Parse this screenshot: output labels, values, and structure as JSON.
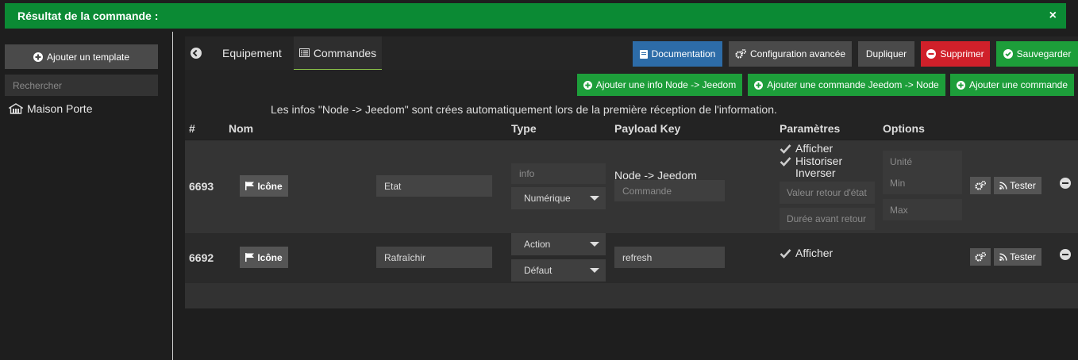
{
  "alert": {
    "text": "Résultat de la commande :",
    "close": "×"
  },
  "sidebar": {
    "add_template_label": "Ajouter un template",
    "search_placeholder": "Rechercher",
    "equipments": [
      {
        "name": "Maison Porte"
      }
    ]
  },
  "tabs": {
    "equipement": "Equipement",
    "commandes": "Commandes"
  },
  "toolbar": {
    "documentation": "Documentation",
    "config_avancee": "Configuration avancée",
    "dupliquer": "Dupliquer",
    "supprimer": "Supprimer",
    "sauvegarder": "Sauvegarder"
  },
  "actions": {
    "add_info": "Ajouter une info Node -> Jeedom",
    "add_cmd_node": "Ajouter une commande Jeedom -> Node",
    "add_cmd": "Ajouter une commande"
  },
  "info_text": "Les infos \"Node -> Jeedom\" sont crées automatiquement lors de la première réception de l'information.",
  "table": {
    "headers": {
      "id": "#",
      "nom": "Nom",
      "type": "Type",
      "payload": "Payload Key",
      "params": "Paramètres",
      "options": "Options"
    },
    "rows": [
      {
        "id": "6693",
        "icon_label": "Icône",
        "name": "Etat",
        "type": "info",
        "subtype": "Numérique",
        "payload_title": "Node -> Jeedom",
        "payload_placeholder": "Commande",
        "params": [
          "Afficher",
          "Historiser",
          "Inverser"
        ],
        "param_placeholders": [
          "Valeur retour d'état",
          "Durée avant retour"
        ],
        "option_placeholders": [
          "Unité",
          "Min",
          "Max"
        ],
        "test_label": "Tester"
      },
      {
        "id": "6692",
        "icon_label": "Icône",
        "name": "Rafraîchir",
        "type": "Action",
        "subtype": "Défaut",
        "payload": "refresh",
        "params": [
          "Afficher"
        ],
        "test_label": "Tester"
      }
    ]
  }
}
